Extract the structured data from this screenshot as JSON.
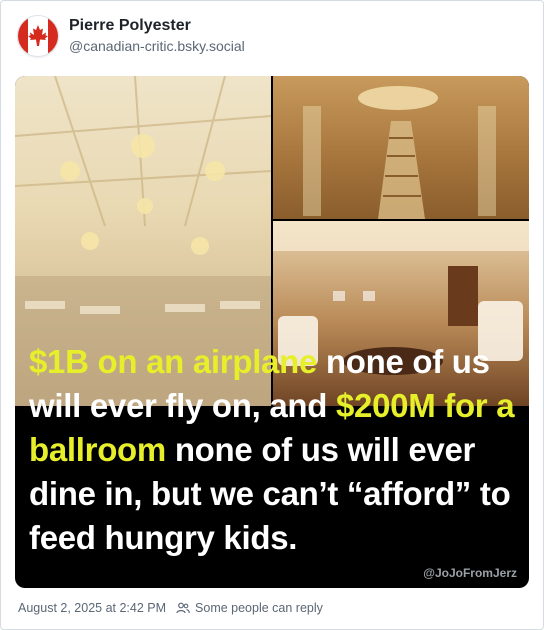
{
  "post": {
    "author": {
      "display_name": "Pierre Polyester",
      "handle": "@canadian-critic.bsky.social",
      "avatar_icon": "canadian-flag-icon"
    },
    "image": {
      "caption_parts": [
        {
          "text": "$1B on an airplane",
          "highlight": true
        },
        {
          "text": " none of us will ever fly on, and ",
          "highlight": false
        },
        {
          "text": "$200M for a ballroom",
          "highlight": true
        },
        {
          "text": " none of us will ever dine in, but we can’t “afford” to feed hungry kids.",
          "highlight": false
        }
      ],
      "watermark": "@JoJoFromJerz",
      "highlight_color": "#e6ef2a"
    },
    "timestamp": "August 2, 2025 at 2:42 PM",
    "reply_setting": {
      "icon": "people-icon",
      "label": "Some people can reply"
    }
  }
}
